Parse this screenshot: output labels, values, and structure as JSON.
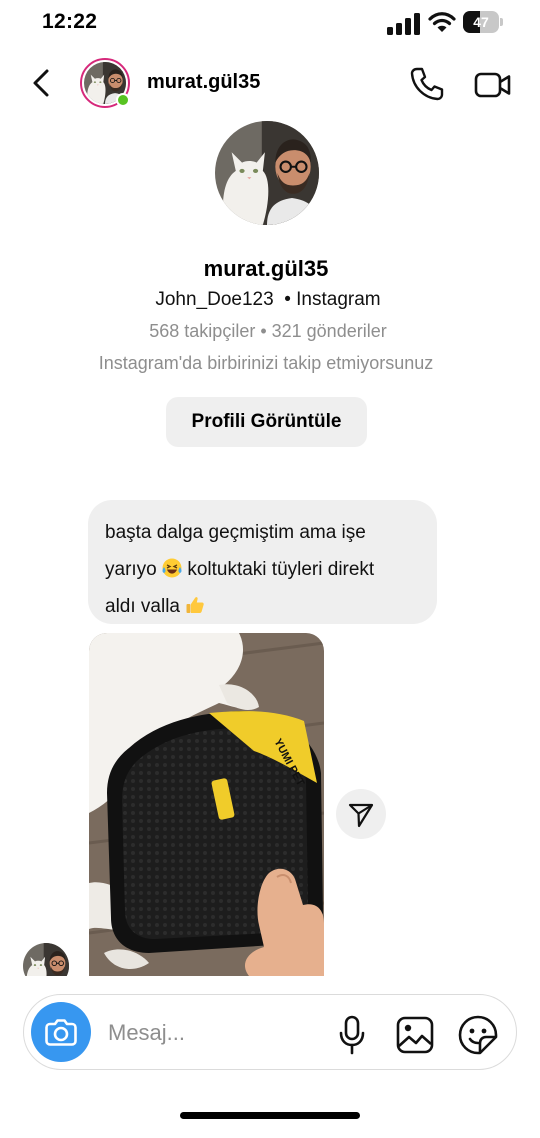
{
  "status_bar": {
    "time": "12:22",
    "battery_level": "47",
    "icons": [
      "signal-icon",
      "wifi-icon",
      "battery-icon"
    ]
  },
  "header": {
    "username": "murat.gül35",
    "online": true,
    "icons": [
      "back-chevron-icon",
      "phone-icon",
      "video-camera-icon"
    ]
  },
  "profile": {
    "name": "murat.gül35",
    "handle_line": "John_Doe123  • Instagram",
    "stats": "568 takipçiler • 321 gönderiler",
    "follow_status": "Instagram'da birbirinizi takip etmiyorsunuz",
    "view_button": "Profili Görüntüle"
  },
  "messages": [
    {
      "type": "text",
      "lines": [
        "başta dalga geçmiştim ama işe",
        "yarıyo",
        "koltuktaki tüyleri direkt",
        "aldı valla"
      ],
      "emojis": [
        "laughing-tears-emoji",
        "thumbs-up-emoji"
      ]
    },
    {
      "type": "image",
      "description_icon": "photo",
      "product_label": "YUMI PET"
    }
  ],
  "composer": {
    "placeholder": "Mesaj...",
    "icons": [
      "camera-icon",
      "microphone-icon",
      "gallery-icon",
      "sticker-icon"
    ]
  },
  "colors": {
    "accent_blue": "#3797f0",
    "bubble_gray": "#efefef",
    "secondary_text": "#8e8e8e",
    "online_green": "#58c322",
    "story_ring": "#d6297b"
  }
}
